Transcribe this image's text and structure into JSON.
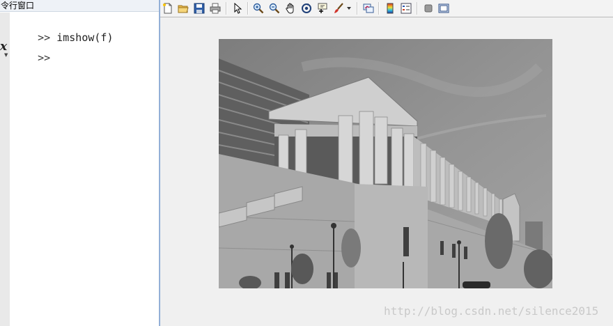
{
  "command_window": {
    "title": "令行窗口",
    "lines": [
      {
        "prompt": ">>",
        "text": " imshow(f)"
      },
      {
        "prompt": ">>",
        "text": ""
      }
    ],
    "fx_glyph": "fx"
  },
  "figure": {
    "toolbar": {
      "buttons": [
        {
          "name": "new-figure-icon"
        },
        {
          "name": "open-file-icon"
        },
        {
          "name": "save-icon"
        },
        {
          "name": "print-icon"
        },
        {
          "name": "edit-plot-arrow-icon"
        },
        {
          "name": "zoom-in-icon"
        },
        {
          "name": "zoom-out-icon"
        },
        {
          "name": "pan-hand-icon"
        },
        {
          "name": "rotate-3d-icon"
        },
        {
          "name": "data-cursor-icon"
        },
        {
          "name": "brush-icon"
        },
        {
          "name": "brush-dropdown-icon"
        },
        {
          "name": "link-plot-icon"
        },
        {
          "name": "colorbar-icon"
        },
        {
          "name": "legend-icon"
        },
        {
          "name": "hide-plot-tools-icon"
        },
        {
          "name": "show-plot-tools-icon"
        }
      ]
    },
    "image": {
      "description_name": "grayscale-building-photo",
      "colors": {
        "sky": "#8c8c8c",
        "building": "#b4b4b4",
        "shadow": "#6a6a6a"
      }
    }
  },
  "watermark": "http://blog.csdn.net/silence2015"
}
